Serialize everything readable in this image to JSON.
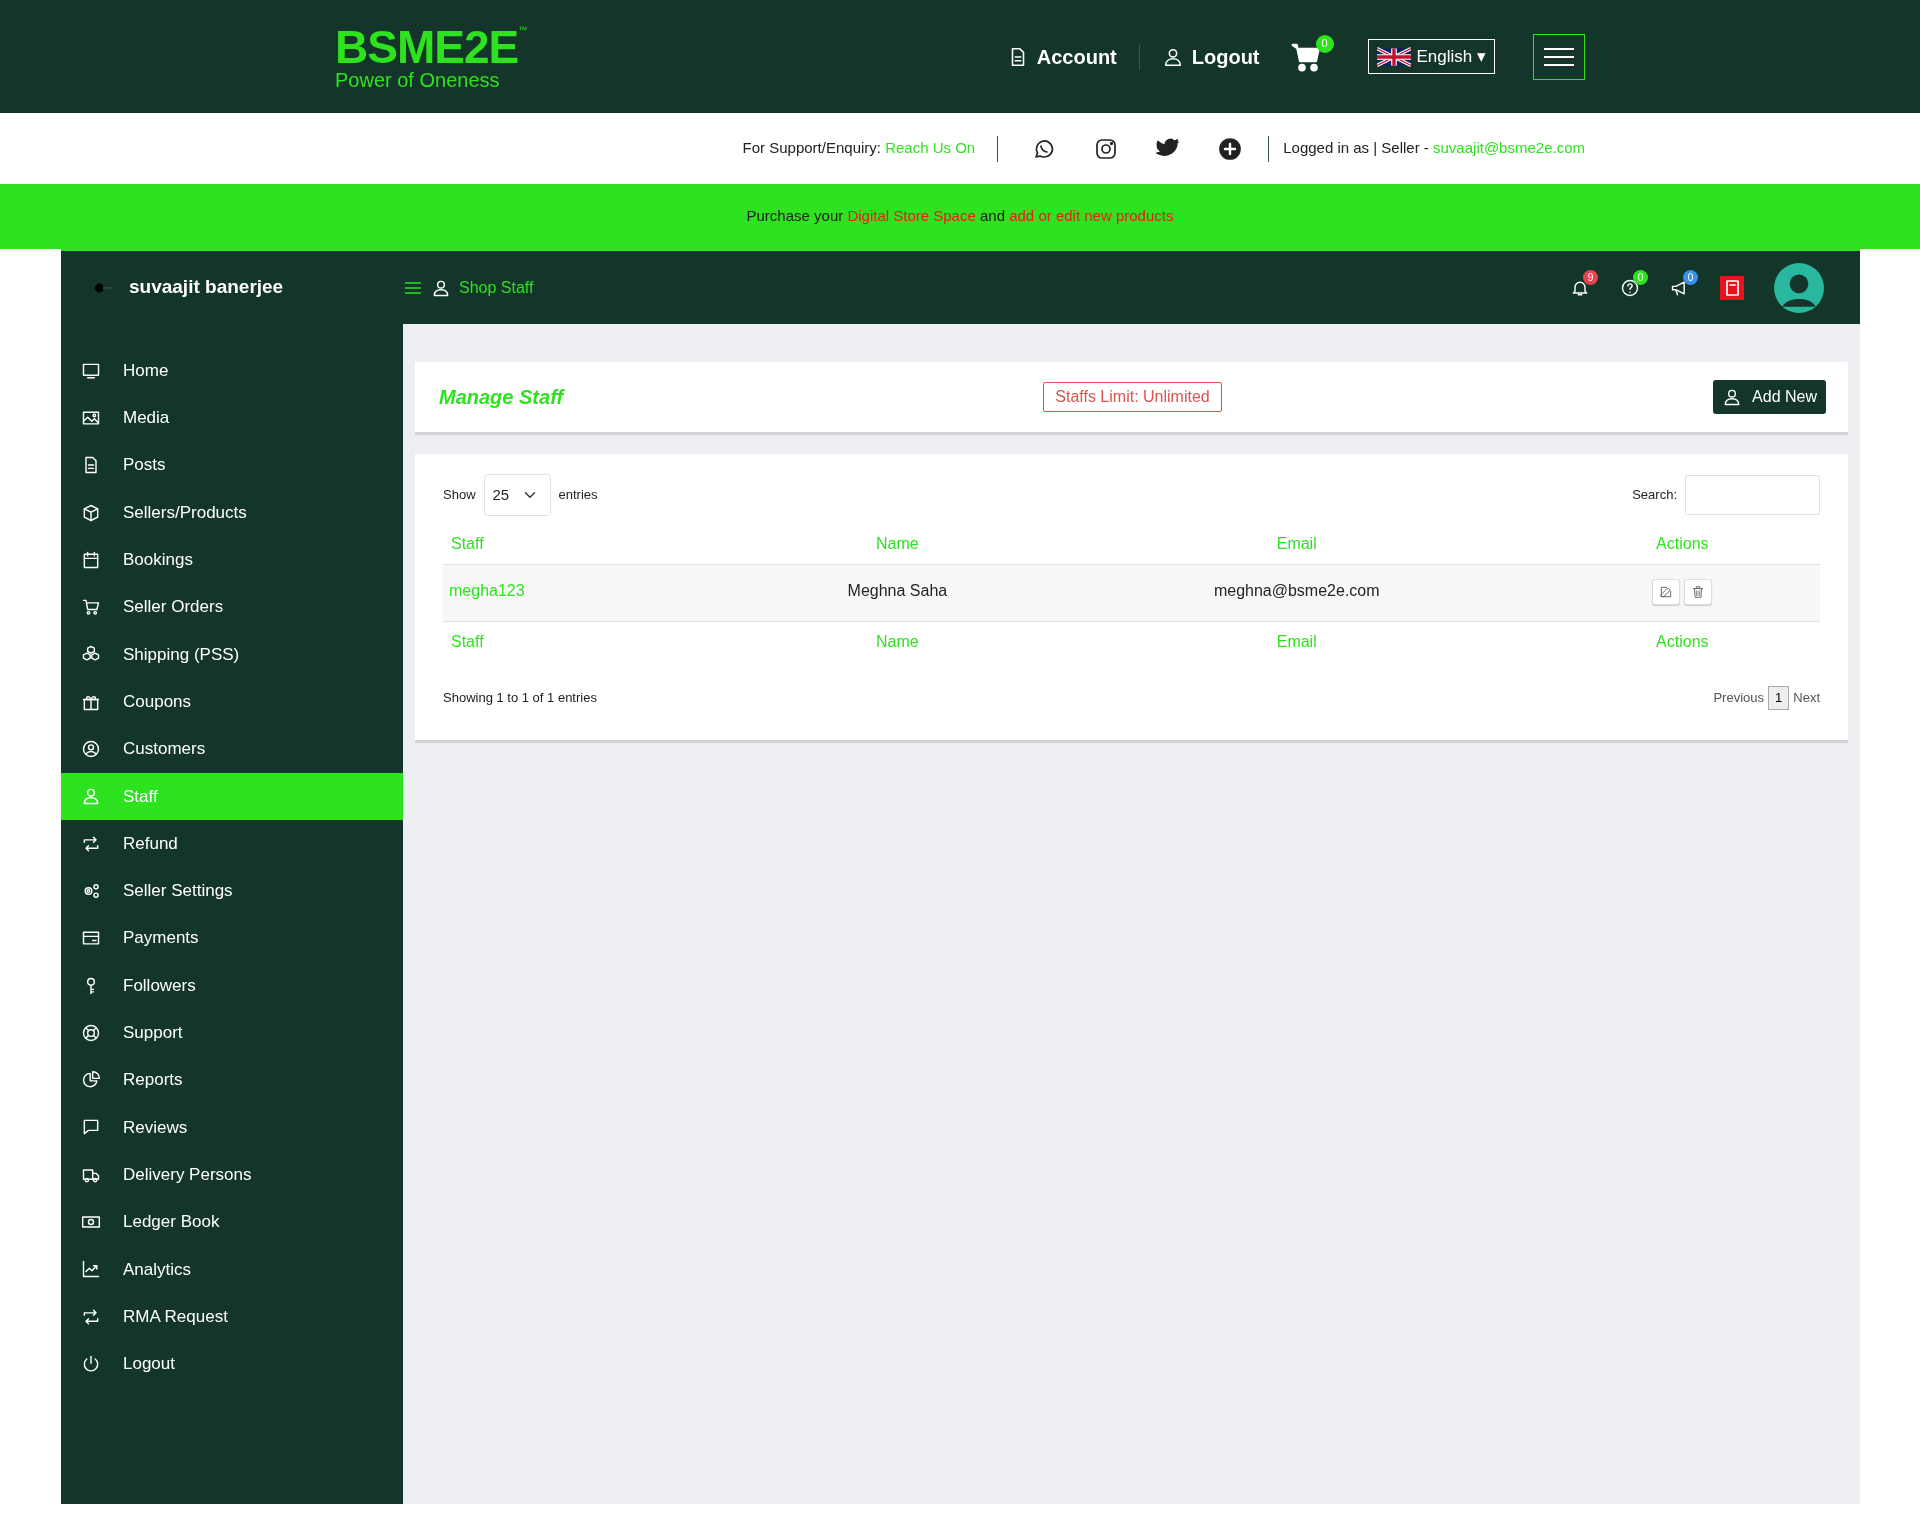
{
  "header": {
    "logo": {
      "name": "BSME2E",
      "trademark": "™",
      "tagline": "Power of Oneness"
    },
    "nav": [
      {
        "label": "Account"
      },
      {
        "label": "Logout"
      }
    ],
    "cart_count": "0",
    "language": "English",
    "language_caret": "▾"
  },
  "support_bar": {
    "prompt": "For Support/Enquiry:",
    "link": "Reach Us On",
    "login_text": "Logged in as | Seller -",
    "email": "suvaajit@bsme2e.com"
  },
  "banner": [
    {
      "text": "Purchase your",
      "kind": "plain"
    },
    {
      "text": "Digital Store Space",
      "kind": "link"
    },
    {
      "text": "and",
      "kind": "plain"
    },
    {
      "text": "add or edit new products",
      "kind": "link"
    }
  ],
  "dashboard": {
    "user_name": "suvaajit banerjee",
    "page_title": "Shop Staff",
    "badges": [
      {
        "count": "9",
        "color": "#e8434f"
      },
      {
        "count": "0",
        "color": "#2ee21f"
      },
      {
        "count": "0",
        "color": "#3b8fe8"
      }
    ]
  },
  "sidebar": {
    "items": [
      {
        "label": "Home",
        "selected": false
      },
      {
        "label": "Media",
        "selected": false
      },
      {
        "label": "Posts",
        "selected": false
      },
      {
        "label": "Sellers/Products",
        "selected": false
      },
      {
        "label": "Bookings",
        "selected": false
      },
      {
        "label": "Seller Orders",
        "selected": false
      },
      {
        "label": "Shipping (PSS)",
        "selected": false
      },
      {
        "label": "Coupons",
        "selected": false
      },
      {
        "label": "Customers",
        "selected": false
      },
      {
        "label": "Staff",
        "selected": true
      },
      {
        "label": "Refund",
        "selected": false
      },
      {
        "label": "Seller Settings",
        "selected": false
      },
      {
        "label": "Payments",
        "selected": false
      },
      {
        "label": "Followers",
        "selected": false
      },
      {
        "label": "Support",
        "selected": false
      },
      {
        "label": "Reports",
        "selected": false
      },
      {
        "label": "Reviews",
        "selected": false
      },
      {
        "label": "Delivery Persons",
        "selected": false
      },
      {
        "label": "Ledger Book",
        "selected": false
      },
      {
        "label": "Analytics",
        "selected": false
      },
      {
        "label": "RMA Request",
        "selected": false
      },
      {
        "label": "Logout",
        "selected": false
      }
    ]
  },
  "manage": {
    "title": "Manage Staff",
    "limit": "Staffs Limit: Unlimited",
    "add_button": "Add New"
  },
  "table": {
    "show_label": "Show",
    "entries_value": "25",
    "entries_label": "entries",
    "search_label": "Search:",
    "columns": [
      "Staff",
      "Name",
      "Email",
      "Actions"
    ],
    "rows": [
      {
        "staff": "megha123",
        "name": "Meghna Saha",
        "email": "meghna@bsme2e.com"
      }
    ],
    "footer_columns": [
      "Staff",
      "Name",
      "Email",
      "Actions"
    ],
    "info": "Showing 1 to 1 of 1 entries",
    "pagination": {
      "previous": "Previous",
      "pages": [
        {
          "label": "1",
          "selected": true
        }
      ],
      "next": "Next"
    }
  }
}
